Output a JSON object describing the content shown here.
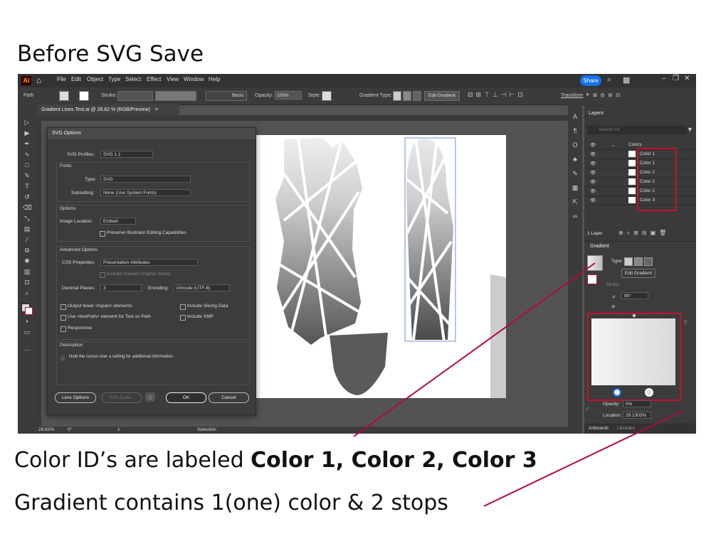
{
  "heading": "Before SVG Save",
  "caption1_prefix": "Color ID’s are labeled ",
  "caption1_bold": "Color 1, Color 2, Color 3",
  "caption2": "Gradient contains 1(one) color & 2 stops",
  "app": {
    "logo": "Ai",
    "menus": [
      "File",
      "Edit",
      "Object",
      "Type",
      "Select",
      "Effect",
      "View",
      "Window",
      "Help"
    ],
    "share_label": "Share"
  },
  "control_bar": {
    "selection_label": "Path",
    "stroke_label": "Stroke:",
    "brush_label": "Basic",
    "opacity_label": "Opacity:",
    "opacity_value": "100%",
    "style_label": "Style:",
    "gradient_type_label": "Gradient Type:",
    "edit_gradient_label": "Edit Gradient",
    "transform_label": "Transform"
  },
  "document_tab": {
    "title": "Gradient Lines Test.ai @ 28.82 % (RGB/Preview)",
    "close": "×"
  },
  "status_bar": {
    "zoom": "28.82%",
    "rotation": "0°",
    "artboard_number": "1",
    "mode": "Selection"
  },
  "svg_dialog": {
    "title": "SVG Options",
    "svg_profiles_label": "SVG Profiles:",
    "svg_profiles_value": "SVG 1.1",
    "fonts_section": "Fonts",
    "type_label": "Type:",
    "type_value": "SVG",
    "subsetting_label": "Subsetting:",
    "subsetting_value": "None (Use System Fonts)",
    "options_section": "Options",
    "image_location_label": "Image Location:",
    "image_location_value": "Embed",
    "preserve_label": "Preserve Illustrator Editing Capabilities",
    "advanced_section": "Advanced Options",
    "css_label": "CSS Properties:",
    "css_value": "Presentation Attributes",
    "unused_styles_label": "Include Unused Graphic Styles",
    "decimal_label": "Decimal Places:",
    "decimal_value": "3",
    "encoding_label": "Encoding:",
    "encoding_value": "Unicode (UTF-8)",
    "output_fewer_label": "Output fewer <tspan> elements",
    "slicing_label": "Include Slicing Data",
    "textpath_label": "Use <textPath> element for Text on Path",
    "xmp_label": "Include XMP",
    "responsive_label": "Responsive",
    "description_section": "Description",
    "description_text": "Hold the cursor over a setting for additional information.",
    "less_options": "Less Options",
    "svg_code": "SVG Code...",
    "ok": "OK",
    "cancel": "Cancel"
  },
  "layers_panel": {
    "tab": "Layers",
    "search_placeholder": "Search All",
    "parent_layer": "Colors",
    "items": [
      "Color 1",
      "Color 1",
      "Color 2",
      "Color 2",
      "Color 2",
      "Color 3"
    ],
    "count": "1 Layer"
  },
  "gradient_panel": {
    "tab": "Gradient",
    "type_label": "Type:",
    "edit_gradient": "Edit Gradient",
    "stroke_label": "Stroke:",
    "angle_value": "90°",
    "opacity_label": "Opacity:",
    "opacity_value": "0%",
    "location_label": "Location:",
    "location_value": "29.1303%"
  },
  "bottom_tabs": [
    "Artboards",
    "Libraries"
  ],
  "colors": {
    "highlight": "#c8102e",
    "share": "#1473e6",
    "panel": "#3a3a3a"
  }
}
